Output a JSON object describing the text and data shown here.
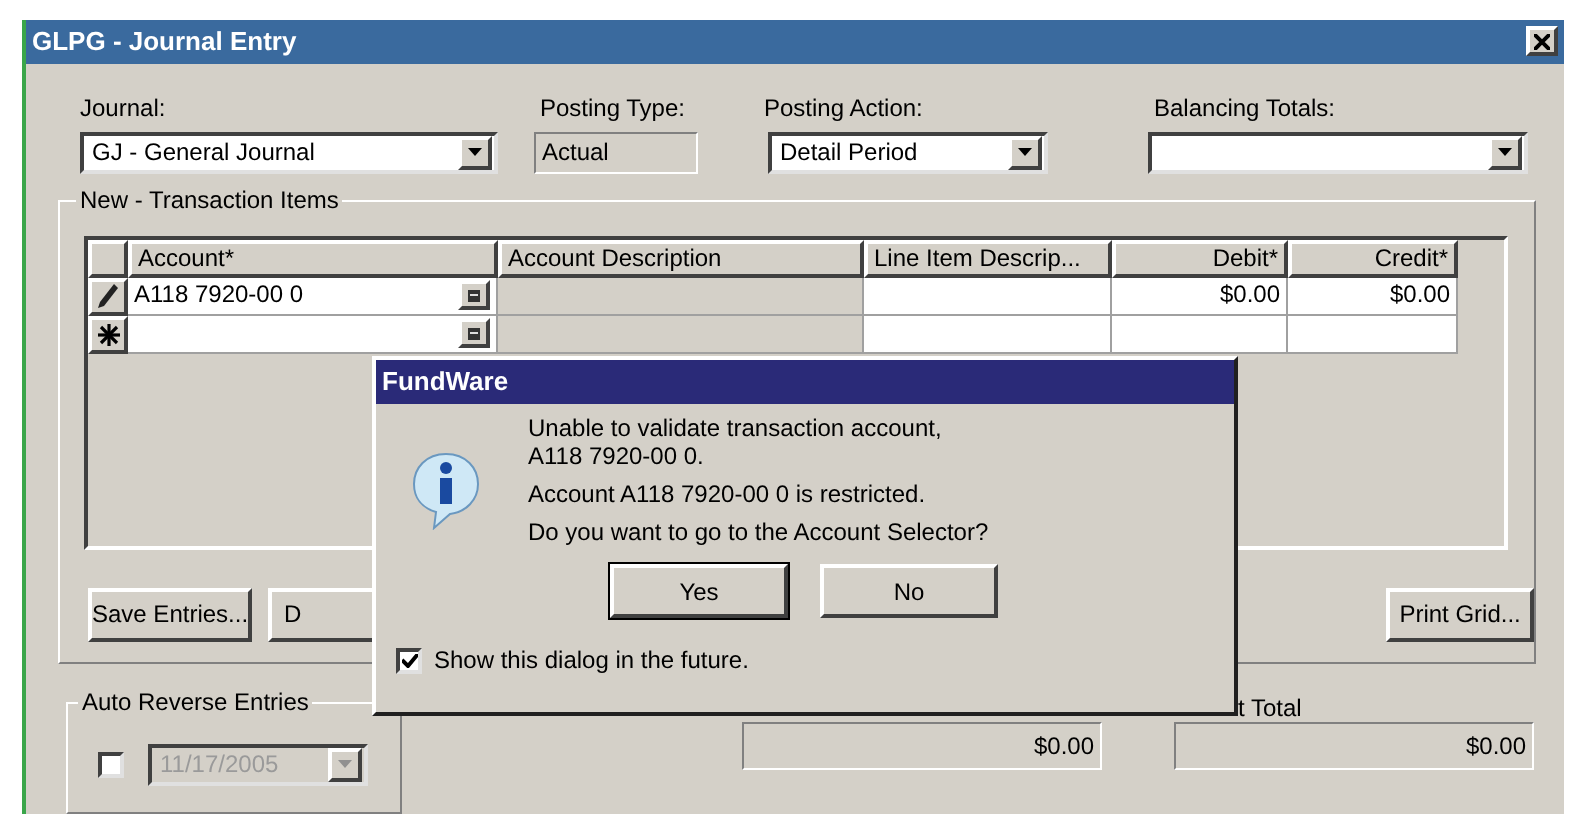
{
  "window": {
    "title": "GLPG - Journal Entry"
  },
  "header": {
    "journal": {
      "label": "Journal:",
      "value": "GJ - General Journal"
    },
    "posting_type": {
      "label": "Posting Type:",
      "value": "Actual"
    },
    "posting_action": {
      "label": "Posting Action:",
      "value": "Detail Period"
    },
    "balancing_totals": {
      "label": "Balancing Totals:"
    }
  },
  "transaction_items": {
    "title": "New - Transaction Items",
    "columns": [
      "Account*",
      "Account Description",
      "Line  Item Descrip...",
      "Debit*",
      "Credit*"
    ],
    "rows": [
      {
        "kind": "editing",
        "account": "A118 7920-00 0",
        "debit": "$0.00",
        "credit": "$0.00"
      },
      {
        "kind": "new"
      }
    ],
    "buttons": [
      "Save Entries...",
      "D",
      "Print Grid..."
    ]
  },
  "auto_reverse": {
    "label": "Auto Reverse Entries",
    "checked": false,
    "date": "11/17/2005",
    "disabled": true
  },
  "totals": [
    {
      "value": "$0.00"
    },
    {
      "label": "t Total",
      "value": "$0.00"
    }
  ],
  "dialog": {
    "title": "FundWare",
    "paragraphs": [
      [
        "Unable to validate transaction account,",
        "A118 7920-00 0."
      ],
      [
        "Account A118 7920-00 0 is restricted."
      ],
      [
        "Do you want to go to the Account Selector?"
      ]
    ],
    "buttons": [
      {
        "label": "Yes",
        "default": true
      },
      {
        "label": "No",
        "default": false
      }
    ],
    "checkbox": {
      "label": "Show this dialog in the future.",
      "checked": true
    }
  }
}
